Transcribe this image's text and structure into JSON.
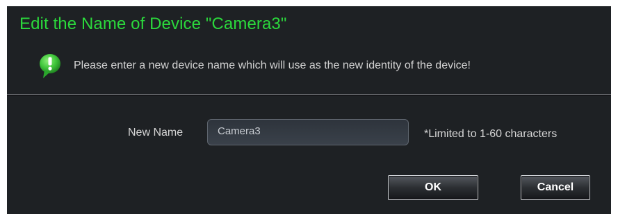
{
  "dialog": {
    "title": "Edit the Name of Device \"Camera3\"",
    "info_icon": "green-speech-bubble-exclamation-icon",
    "info_message": "Please enter a new device name which will use as the new identity of the device!",
    "name_label": "New Name",
    "name_value": "Camera3",
    "limit_note": "*Limited to 1-60 characters",
    "ok_label": "OK",
    "cancel_label": "Cancel"
  },
  "colors": {
    "title": "#2bd93c",
    "background": "#1e2124",
    "icon": "#3ec43a"
  }
}
